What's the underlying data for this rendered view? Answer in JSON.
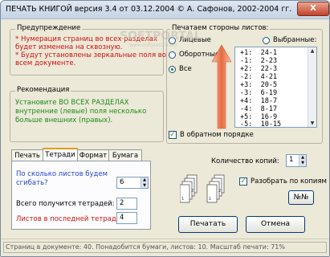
{
  "window": {
    "title": "ПЕЧАТЬ КНИГОЙ   версия 3.4 от 03.12.2004   © А. Сафонов, 2002-2004 гг.",
    "close_label": "X"
  },
  "warning": {
    "label": "Предупреждение",
    "lines": [
      "* Нумерация страниц во всех разделах",
      "будет изменена на сквозную.",
      "* Будут установлены зеркальные поля во",
      "всем документе."
    ]
  },
  "recommendation": {
    "label": "Рекомендация",
    "lines": [
      "Установите ВО ВСЕХ РАЗДЕЛАХ",
      "внутренние (левые) поля несколько",
      "больше внешних (правых)."
    ]
  },
  "print_sides": {
    "label": "Печатаем стороны листов:",
    "options": [
      "Лицевые",
      "Оборотные",
      "Все"
    ],
    "selected_label": "Выбранные:",
    "list": [
      "+1:  24-1",
      "-1:  2-23",
      "+2:  22-3",
      "-2:  4-21",
      "+3:  20-5",
      "-3:  6-19",
      "+4:  18-7",
      "-4:  8-17",
      "+5:  16-9",
      "-5:  10-15"
    ],
    "reverse_label": "В обратном порядке",
    "reverse_checked": true
  },
  "tabs": [
    "Печать",
    "Тетради",
    "Формат",
    "Бумага"
  ],
  "notebooks": {
    "q_label_1": "По сколько листов будем",
    "q_label_2": "сгибать?",
    "sheets_value": "6",
    "total_label": "Всего получится тетрадей:",
    "total_value": "2",
    "last_label": "Листов в последней тетради:",
    "last_value": "4"
  },
  "copies": {
    "label": "Количество копий:",
    "value": "1",
    "collate_label": "Разобрать по копиям",
    "collate_checked": true,
    "numbering_button": "№№"
  },
  "buttons": {
    "print": "Печатать",
    "cancel": "Отмена"
  },
  "status": {
    "text": "Страниц в документе: 40. Понадобится бумаги, листов: 10. Масштаб печати: 71%"
  },
  "watermark": {
    "text": "SOFTPORTAL",
    "sub": "www.softportal.com"
  },
  "colors": {
    "warning_text": "#cc1111",
    "recommendation_text": "#1c8a1c",
    "question_text": "#2244cc"
  }
}
